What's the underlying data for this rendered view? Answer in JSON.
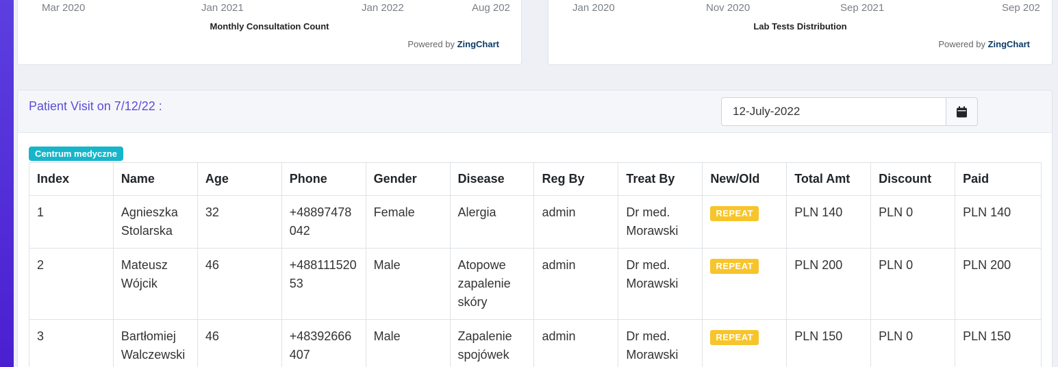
{
  "charts": [
    {
      "axis_labels": [
        "Mar 2020",
        "Jan 2021",
        "Jan 2022",
        "Aug 202"
      ],
      "title": "Monthly Consultation Count",
      "powered_prefix": "Powered by",
      "powered_brand": "ZingChart"
    },
    {
      "axis_labels": [
        "Jan 2020",
        "Nov 2020",
        "Sep 2021",
        "Sep 202"
      ],
      "title": "Lab Tests Distribution",
      "powered_prefix": "Powered by",
      "powered_brand": "ZingChart"
    }
  ],
  "visit": {
    "title": "Patient Visit on 7/12/22 :",
    "date_value": "12-July-2022",
    "clinic_badge": "Centrum medyczne",
    "columns": [
      "Index",
      "Name",
      "Age",
      "Phone",
      "Gender",
      "Disease",
      "Reg By",
      "Treat By",
      "New/Old",
      "Total Amt",
      "Discount",
      "Paid"
    ],
    "rows": [
      {
        "index": "1",
        "name": "Agnieszka Stolarska",
        "age": "32",
        "phone": "+48897478042",
        "gender": "Female",
        "disease": "Alergia",
        "reg_by": "admin",
        "treat_by": "Dr med. Morawski",
        "status": "REPEAT",
        "total": "PLN 140",
        "discount": "PLN 0",
        "paid": "PLN 140"
      },
      {
        "index": "2",
        "name": "Mateusz Wójcik",
        "age": "46",
        "phone": "+48811152053",
        "gender": "Male",
        "disease": "Atopowe zapalenie skóry",
        "reg_by": "admin",
        "treat_by": "Dr med. Morawski",
        "status": "REPEAT",
        "total": "PLN 200",
        "discount": "PLN 0",
        "paid": "PLN 200"
      },
      {
        "index": "3",
        "name": "Bartłomiej Walczewski",
        "age": "46",
        "phone": "+48392666407",
        "gender": "Male",
        "disease": "Zapalenie spojówek",
        "reg_by": "admin",
        "treat_by": "Dr med. Morawski",
        "status": "REPEAT",
        "total": "PLN 150",
        "discount": "PLN 0",
        "paid": "PLN 150"
      }
    ]
  },
  "colors": {
    "sidebar": "#4a1fd0",
    "title_accent": "#5a4fd6",
    "badge_info": "#17b5c9",
    "badge_warning": "#f7c52b"
  },
  "icons": {
    "date_button": "calendar-icon"
  }
}
